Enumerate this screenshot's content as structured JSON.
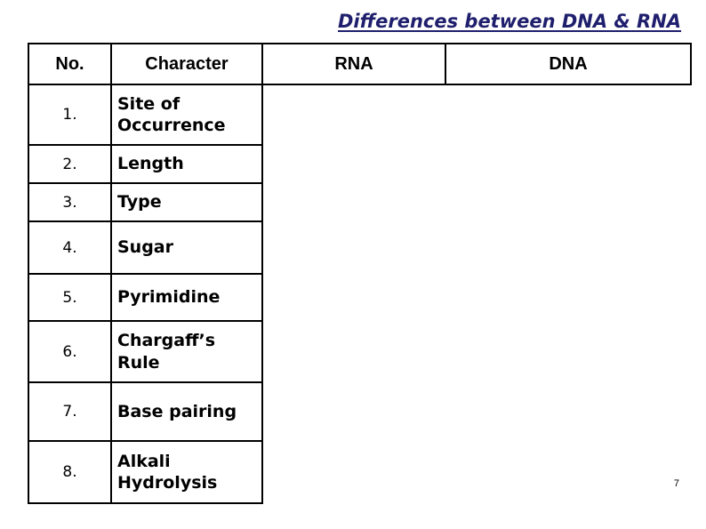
{
  "slide": {
    "title": "Differences between DNA & RNA",
    "title_color": "#1F1F6E",
    "page_number": "7",
    "background_color": "#FFFFFF",
    "border_color": "#000000"
  },
  "table": {
    "headers": {
      "no": "No.",
      "character": "Character",
      "rna": "RNA",
      "dna": "DNA"
    },
    "rows": [
      {
        "no": "1.",
        "character": "Site of Occurrence",
        "rna": "",
        "dna": ""
      },
      {
        "no": "2.",
        "character": "Length",
        "rna": "",
        "dna": ""
      },
      {
        "no": "3.",
        "character": "Type",
        "rna": "",
        "dna": ""
      },
      {
        "no": "4.",
        "character": "Sugar",
        "rna": "",
        "dna": ""
      },
      {
        "no": "5.",
        "character": "Pyrimidine",
        "rna": "",
        "dna": ""
      },
      {
        "no": "6.",
        "character": "Chargaff’s Rule",
        "rna": "",
        "dna": ""
      },
      {
        "no": "7.",
        "character": "Base pairing",
        "rna": "",
        "dna": ""
      },
      {
        "no": "8.",
        "character": "Alkali Hydrolysis",
        "rna": "",
        "dna": ""
      }
    ]
  }
}
